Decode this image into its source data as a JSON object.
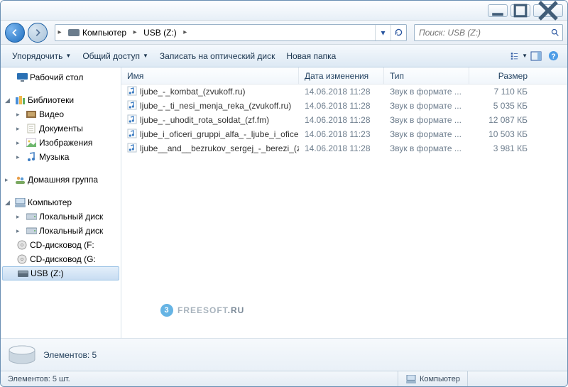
{
  "nav": {
    "breadcrumbs": [
      "Компьютер",
      "USB (Z:)"
    ],
    "search_placeholder": "Поиск: USB (Z:)"
  },
  "toolbar": {
    "organize": "Упорядочить",
    "share": "Общий доступ",
    "burn": "Записать на оптический диск",
    "new_folder": "Новая папка"
  },
  "sidebar": {
    "desktop": "Рабочий стол",
    "libraries": "Библиотеки",
    "video": "Видео",
    "documents": "Документы",
    "pictures": "Изображения",
    "music": "Музыка",
    "homegroup": "Домашняя группа",
    "computer": "Компьютер",
    "local_disk": "Локальный диск",
    "cd_f": "CD-дисковод (F:",
    "cd_g": "CD-дисковод (G:",
    "usb": "USB (Z:)"
  },
  "columns": {
    "name": "Имя",
    "date": "Дата изменения",
    "type": "Тип",
    "size": "Размер"
  },
  "files": [
    {
      "name": "ljube_-_kombat_(zvukoff.ru)",
      "date": "14.06.2018 11:28",
      "type": "Звук в формате ...",
      "size": "7 110 КБ"
    },
    {
      "name": "ljube_-_ti_nesi_menja_reka_(zvukoff.ru)",
      "date": "14.06.2018 11:28",
      "type": "Звук в формате ...",
      "size": "5 035 КБ"
    },
    {
      "name": "ljube_-_uhodit_rota_soldat_(zf.fm)",
      "date": "14.06.2018 11:28",
      "type": "Звук в формате ...",
      "size": "12 087 КБ"
    },
    {
      "name": "ljube_i_oficeri_gruppi_alfa_-_ljube_i_ofice...",
      "date": "14.06.2018 11:23",
      "type": "Звук в формате ...",
      "size": "10 503 КБ"
    },
    {
      "name": "ljube__and__bezrukov_sergej_-_berezi_(zv...",
      "date": "14.06.2018 11:28",
      "type": "Звук в формате ...",
      "size": "3 981 КБ"
    }
  ],
  "details": {
    "count_label": "Элементов: 5"
  },
  "status": {
    "left": "Элементов: 5 шт.",
    "right": "Компьютер"
  },
  "watermark": {
    "brand1": "FREESOFT",
    "brand2": ".RU",
    "num": "3"
  }
}
